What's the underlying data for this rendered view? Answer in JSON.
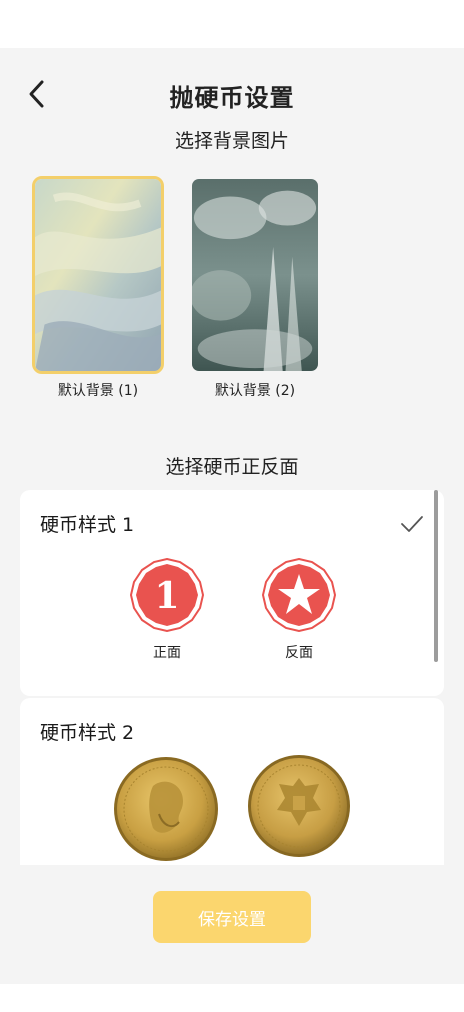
{
  "header": {
    "title": "抛硬币设置",
    "back_icon": "chevron-left-icon"
  },
  "background_section": {
    "title": "选择背景图片",
    "options": [
      {
        "label": "默认背景 (1)",
        "selected": true
      },
      {
        "label": "默认背景 (2)",
        "selected": false
      }
    ]
  },
  "coin_section": {
    "title": "选择硬币正反面",
    "styles": [
      {
        "name": "硬币样式 1",
        "selected": true,
        "front_label": "正面",
        "back_label": "反面",
        "front_numeral": "1"
      },
      {
        "name": "硬币样式 2",
        "selected": false
      }
    ]
  },
  "save_button": {
    "label": "保存设置"
  },
  "colors": {
    "accent": "#fbd66e",
    "selected_border": "#f3cf6a",
    "coin_red": "#e9534f",
    "background": "#f4f4f4"
  }
}
